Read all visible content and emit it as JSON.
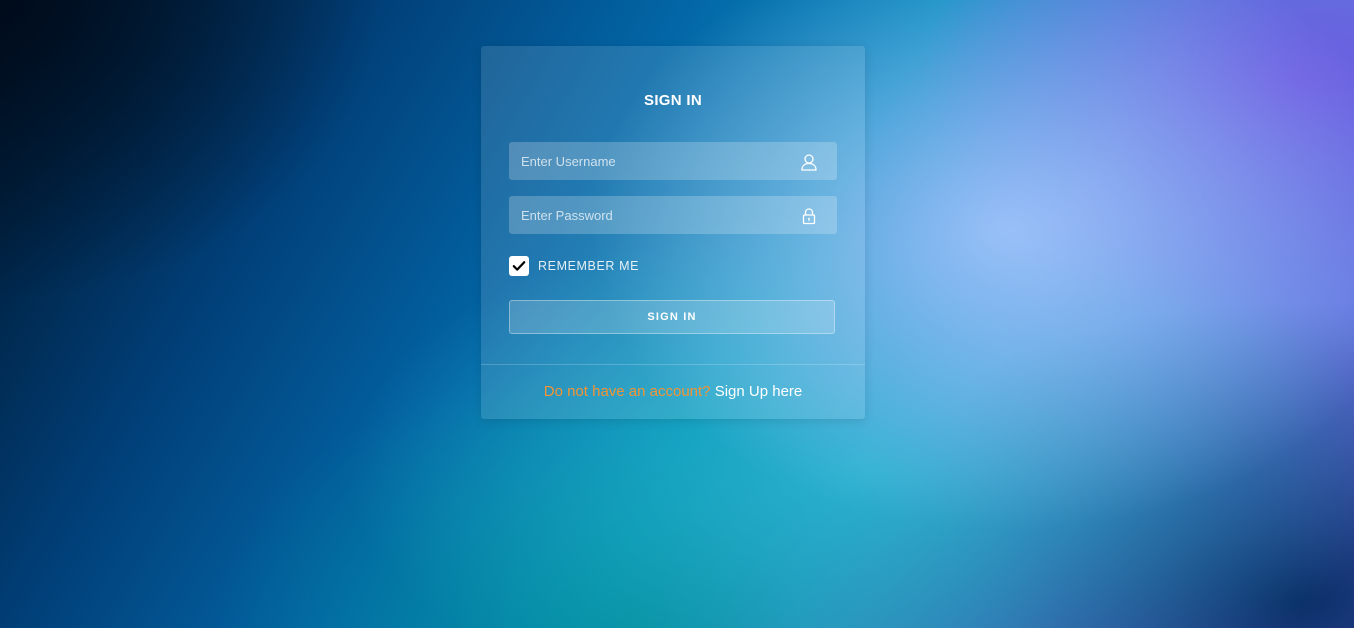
{
  "form": {
    "title": "SIGN IN",
    "username": {
      "placeholder": "Enter Username",
      "value": "",
      "icon": "user-icon"
    },
    "password": {
      "placeholder": "Enter Password",
      "value": "",
      "icon": "lock-icon"
    },
    "remember": {
      "label": "REMEMBER ME",
      "checked": true,
      "icon": "checkmark-icon"
    },
    "submit_label": "SIGN IN"
  },
  "footer": {
    "prompt": "Do not have an account?",
    "link_label": "Sign Up here"
  },
  "colors": {
    "prompt": "#f39434",
    "link": "#ffffff",
    "title": "#ffffff"
  }
}
